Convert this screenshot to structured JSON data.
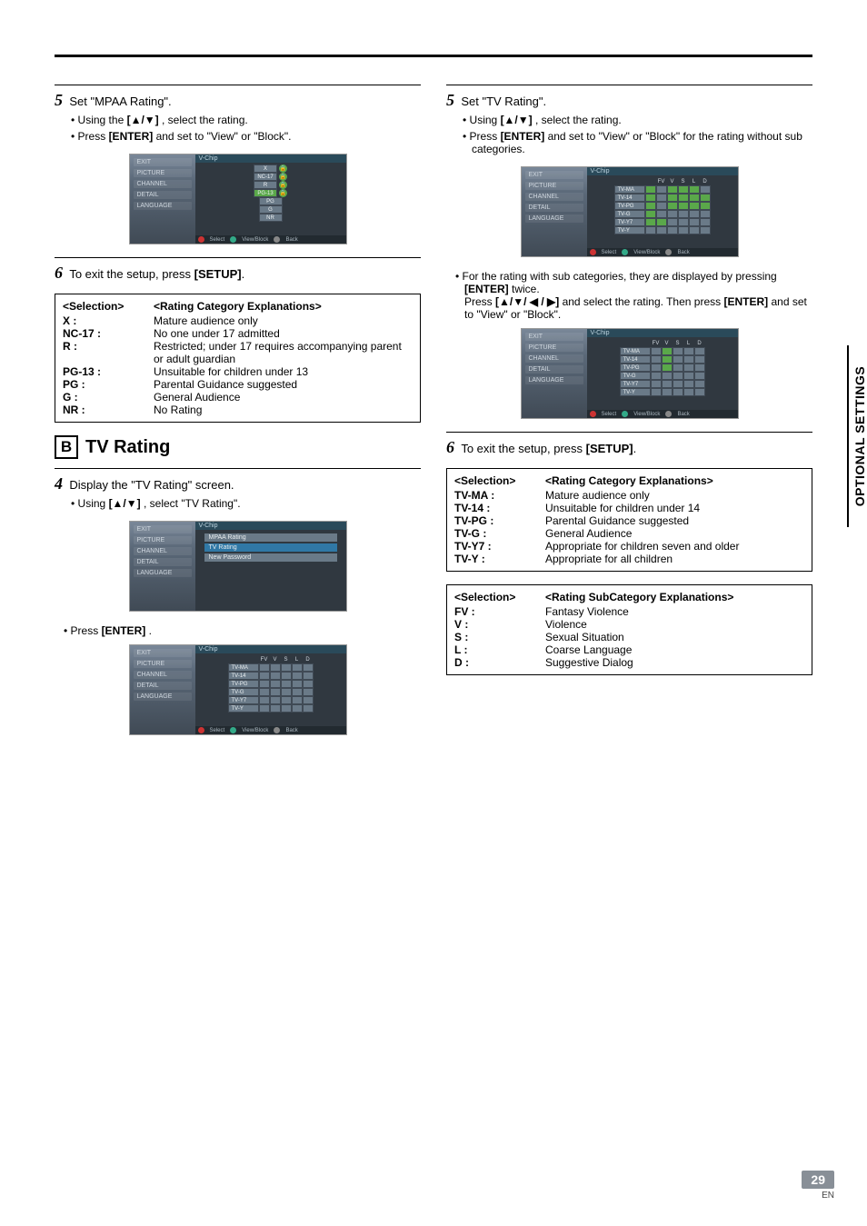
{
  "sidetab": "OPTIONAL SETTINGS",
  "footer": {
    "page": "29",
    "lang": "EN"
  },
  "left": {
    "step5": {
      "num": "5",
      "text": "Set \"MPAA Rating\".",
      "b1_pre": "Using the ",
      "b1_bold": "[▲/▼]",
      "b1_post": ", select the rating.",
      "b2_pre": "Press ",
      "b2_bold": "[ENTER]",
      "b2_post": " and set to \"View\" or \"Block\"."
    },
    "vchip1": {
      "title": "V-Chip",
      "side": [
        "EXIT",
        "PICTURE",
        "CHANNEL",
        "DETAIL",
        "LANGUAGE"
      ],
      "rows": [
        "X",
        "NC-17",
        "R",
        "PG-13",
        "PG",
        "G",
        "NR"
      ],
      "hl": "PG-13",
      "foot": [
        "Select",
        "View/Block",
        "Back"
      ]
    },
    "step6": {
      "num": "6",
      "pre": "To exit the setup, press ",
      "bold": "[SETUP]",
      "post": "."
    },
    "deftable1": {
      "head": {
        "k": "<Selection>",
        "v": "<Rating Category Explanations>"
      },
      "rows": [
        {
          "k": "X :",
          "v": "Mature audience only"
        },
        {
          "k": "NC-17 :",
          "v": "No one under 17 admitted"
        },
        {
          "k": "R :",
          "v": "Restricted; under 17 requires accompanying parent or adult guardian"
        },
        {
          "k": "PG-13 :",
          "v": "Unsuitable for children under 13"
        },
        {
          "k": "PG :",
          "v": "Parental Guidance suggested"
        },
        {
          "k": "G :",
          "v": "General Audience"
        },
        {
          "k": "NR :",
          "v": "No Rating"
        }
      ]
    },
    "sectionB": {
      "letter": "B",
      "title": "TV Rating"
    },
    "step4": {
      "num": "4",
      "text": "Display the \"TV Rating\" screen.",
      "b1_pre": "Using ",
      "b1_bold": "[▲/▼]",
      "b1_post": ", select \"TV Rating\"."
    },
    "vchip2": {
      "title": "V-Chip",
      "side": [
        "EXIT",
        "PICTURE",
        "CHANNEL",
        "DETAIL",
        "LANGUAGE"
      ],
      "items": [
        "MPAA Rating",
        "TV Rating",
        "New Password"
      ],
      "hl": "TV Rating"
    },
    "pressEnter": {
      "pre": "Press ",
      "bold": "[ENTER]",
      "post": "."
    },
    "vchip3": {
      "title": "V-Chip",
      "side": [
        "EXIT",
        "PICTURE",
        "CHANNEL",
        "DETAIL",
        "LANGUAGE"
      ],
      "cols": [
        "FV",
        "V",
        "S",
        "L",
        "D"
      ],
      "rows": [
        "TV-MA",
        "TV-14",
        "TV-PG",
        "TV-G",
        "TV-Y7",
        "TV-Y"
      ],
      "foot": [
        "Select",
        "View/Block",
        "Back"
      ]
    }
  },
  "right": {
    "step5": {
      "num": "5",
      "text": "Set \"TV Rating\".",
      "b1_pre": "Using ",
      "b1_bold": "[▲/▼]",
      "b1_post": ", select the rating.",
      "b2_pre": "Press ",
      "b2_bold": "[ENTER]",
      "b2_post": " and set to \"View\" or \"Block\" for the rating without sub categories."
    },
    "vchip4": {
      "title": "V-Chip",
      "side": [
        "EXIT",
        "PICTURE",
        "CHANNEL",
        "DETAIL",
        "LANGUAGE"
      ],
      "cols": [
        "FV",
        "V",
        "S",
        "L",
        "D"
      ],
      "rows": [
        "TV-MA",
        "TV-14",
        "TV-PG",
        "TV-G",
        "TV-Y7",
        "TV-Y"
      ],
      "foot": [
        "Select",
        "View/Block",
        "Back"
      ]
    },
    "subnote": {
      "b_pre": "For the rating with sub categories, they are displayed by pressing ",
      "b_bold": "[ENTER]",
      "b_post": " twice.",
      "l2_pre": "Press ",
      "l2_bold": "[▲/▼/ ◀ / ▶]",
      "l2_post": " and select the rating. Then press ",
      "l2_bold2": "[ENTER]",
      "l2_post2": " and set to \"View\" or \"Block\"."
    },
    "vchip5": {
      "title": "V-Chip",
      "side": [
        "EXIT",
        "PICTURE",
        "CHANNEL",
        "DETAIL",
        "LANGUAGE"
      ],
      "cols": [
        "FV",
        "V",
        "S",
        "L",
        "D"
      ],
      "rows": [
        "TV-MA",
        "TV-14",
        "TV-PG",
        "TV-G",
        "TV-Y7",
        "TV-Y"
      ],
      "foot": [
        "Select",
        "View/Block",
        "Back"
      ]
    },
    "step6": {
      "num": "6",
      "pre": "To exit the setup, press ",
      "bold": "[SETUP]",
      "post": "."
    },
    "deftable2": {
      "head": {
        "k": "<Selection>",
        "v": "<Rating Category Explanations>"
      },
      "rows": [
        {
          "k": "TV-MA :",
          "v": "Mature audience only"
        },
        {
          "k": "TV-14 :",
          "v": "Unsuitable for children under 14"
        },
        {
          "k": "TV-PG :",
          "v": "Parental Guidance suggested"
        },
        {
          "k": "TV-G :",
          "v": "General Audience"
        },
        {
          "k": "TV-Y7 :",
          "v": "Appropriate for children seven and older"
        },
        {
          "k": "TV-Y :",
          "v": "Appropriate for all children"
        }
      ]
    },
    "deftable3": {
      "head": {
        "k": "<Selection>",
        "v": "<Rating SubCategory Explanations>"
      },
      "rows": [
        {
          "k": "FV :",
          "v": "Fantasy Violence"
        },
        {
          "k": "V :",
          "v": "Violence"
        },
        {
          "k": "S :",
          "v": "Sexual Situation"
        },
        {
          "k": "L :",
          "v": "Coarse Language"
        },
        {
          "k": "D :",
          "v": "Suggestive Dialog"
        }
      ]
    }
  }
}
